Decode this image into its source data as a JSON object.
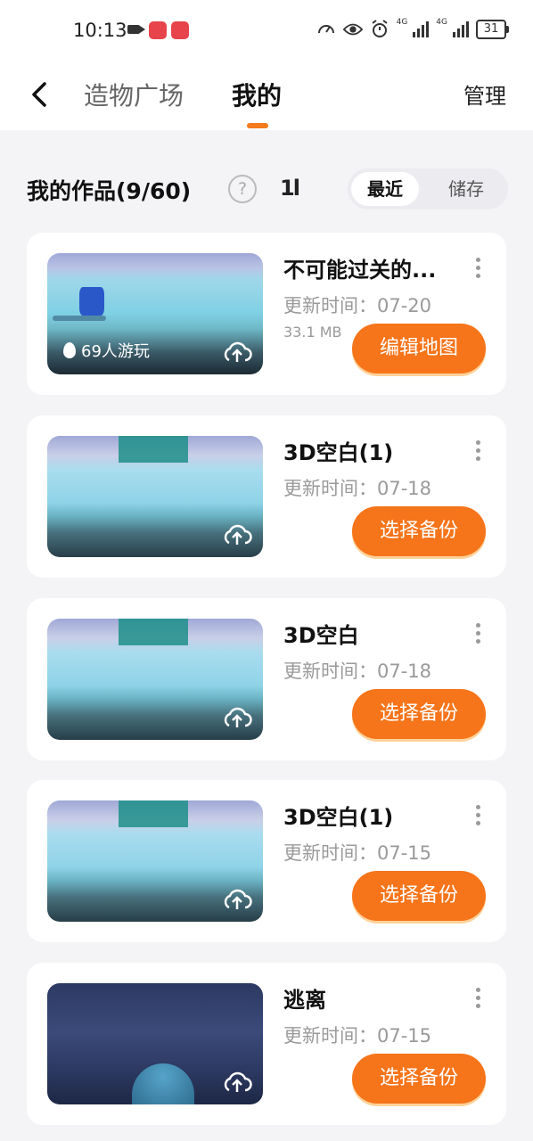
{
  "status": {
    "time": "10:13",
    "battery": "31",
    "net1": "4G",
    "net2": "4G"
  },
  "nav": {
    "tab_square": "造物广场",
    "tab_mine": "我的",
    "manage": "管理"
  },
  "section": {
    "title": "我的作品(9/60)",
    "help": "?",
    "sort": "1l",
    "filter_recent": "最近",
    "filter_storage": "储存"
  },
  "items": [
    {
      "title": "不可能过关的...",
      "updated": "更新时间：07-20",
      "size": "33.1 MB",
      "players": "69人游玩",
      "button": "编辑地图"
    },
    {
      "title": "3D空白(1)",
      "updated": "更新时间：07-18",
      "button": "选择备份"
    },
    {
      "title": "3D空白",
      "updated": "更新时间：07-18",
      "button": "选择备份"
    },
    {
      "title": "3D空白(1)",
      "updated": "更新时间：07-15",
      "button": "选择备份"
    },
    {
      "title": "逃离",
      "updated": "更新时间：07-15",
      "button": "选择备份"
    }
  ],
  "colors": {
    "accent": "#f6741a",
    "background": "#f4f3f6"
  }
}
